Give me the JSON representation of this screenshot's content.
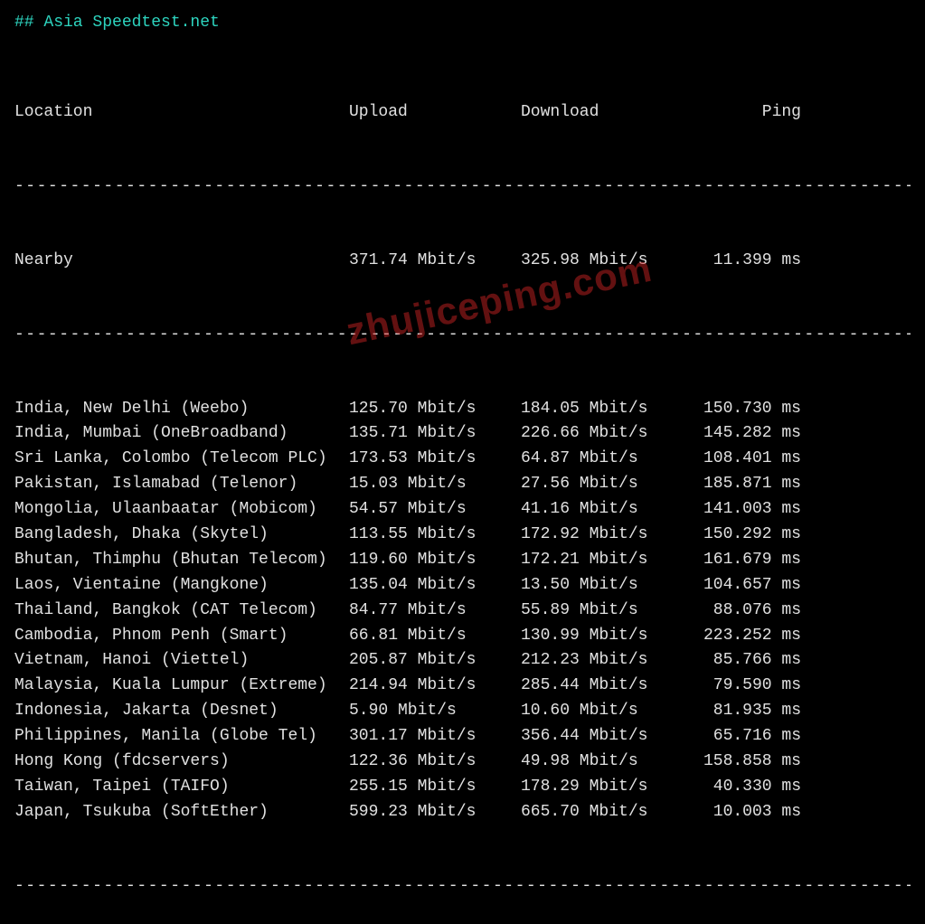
{
  "title": "## Asia Speedtest.net",
  "headers": {
    "location": "Location",
    "upload": "Upload",
    "download": "Download",
    "ping": "Ping"
  },
  "nearby": {
    "location": "Nearby",
    "upload": "371.74 Mbit/s",
    "download": "325.98 Mbit/s",
    "ping": "11.399 ms"
  },
  "rows": [
    {
      "location": "India, New Delhi (Weebo)",
      "upload": "125.70 Mbit/s",
      "download": "184.05 Mbit/s",
      "ping": "150.730 ms"
    },
    {
      "location": "India, Mumbai (OneBroadband)",
      "upload": "135.71 Mbit/s",
      "download": "226.66 Mbit/s",
      "ping": "145.282 ms"
    },
    {
      "location": "Sri Lanka, Colombo (Telecom PLC)",
      "upload": "173.53 Mbit/s",
      "download": "64.87 Mbit/s",
      "ping": "108.401 ms"
    },
    {
      "location": "Pakistan, Islamabad (Telenor)",
      "upload": "15.03 Mbit/s",
      "download": "27.56 Mbit/s",
      "ping": "185.871 ms"
    },
    {
      "location": "Mongolia, Ulaanbaatar (Mobicom)",
      "upload": "54.57 Mbit/s",
      "download": "41.16 Mbit/s",
      "ping": "141.003 ms"
    },
    {
      "location": "Bangladesh, Dhaka (Skytel)",
      "upload": "113.55 Mbit/s",
      "download": "172.92 Mbit/s",
      "ping": "150.292 ms"
    },
    {
      "location": "Bhutan, Thimphu (Bhutan Telecom)",
      "upload": "119.60 Mbit/s",
      "download": "172.21 Mbit/s",
      "ping": "161.679 ms"
    },
    {
      "location": "Laos, Vientaine (Mangkone)",
      "upload": "135.04 Mbit/s",
      "download": "13.50 Mbit/s",
      "ping": "104.657 ms"
    },
    {
      "location": "Thailand, Bangkok (CAT Telecom)",
      "upload": "84.77 Mbit/s",
      "download": "55.89 Mbit/s",
      "ping": "88.076 ms"
    },
    {
      "location": "Cambodia, Phnom Penh (Smart)",
      "upload": "66.81 Mbit/s",
      "download": "130.99 Mbit/s",
      "ping": "223.252 ms"
    },
    {
      "location": "Vietnam, Hanoi (Viettel)",
      "upload": "205.87 Mbit/s",
      "download": "212.23 Mbit/s",
      "ping": "85.766 ms"
    },
    {
      "location": "Malaysia, Kuala Lumpur (Extreme)",
      "upload": "214.94 Mbit/s",
      "download": "285.44 Mbit/s",
      "ping": "79.590 ms"
    },
    {
      "location": "Indonesia, Jakarta (Desnet)",
      "upload": "5.90 Mbit/s",
      "download": "10.60 Mbit/s",
      "ping": "81.935 ms"
    },
    {
      "location": "Philippines, Manila (Globe Tel)",
      "upload": "301.17 Mbit/s",
      "download": "356.44 Mbit/s",
      "ping": "65.716 ms"
    },
    {
      "location": "Hong Kong (fdcservers)",
      "upload": "122.36 Mbit/s",
      "download": "49.98 Mbit/s",
      "ping": "158.858 ms"
    },
    {
      "location": "Taiwan, Taipei (TAIFO)",
      "upload": "255.15 Mbit/s",
      "download": "178.29 Mbit/s",
      "ping": "40.330 ms"
    },
    {
      "location": "Japan, Tsukuba (SoftEther)",
      "upload": "599.23 Mbit/s",
      "download": "665.70 Mbit/s",
      "ping": "10.003 ms"
    }
  ],
  "watermark": "zhujiceping.com"
}
